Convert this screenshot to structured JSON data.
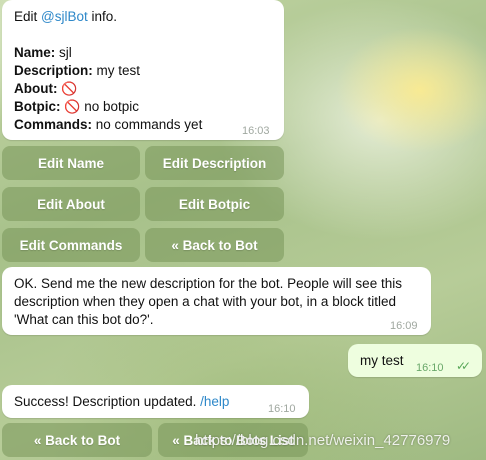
{
  "bot_info": {
    "intro_prefix": "Edit ",
    "bot_handle": "@sjlBot",
    "intro_suffix": " info.",
    "name_label": "Name:",
    "name_value": " sjl",
    "description_label": "Description:",
    "description_value": " my test",
    "about_label": "About:",
    "about_icon": "🚫",
    "botpic_label": "Botpic:",
    "botpic_icon": "🚫",
    "botpic_value": " no botpic",
    "commands_label": "Commands:",
    "commands_value": " no commands yet",
    "time": "16:03"
  },
  "keyboard": {
    "edit_name": "Edit Name",
    "edit_description": "Edit Description",
    "edit_about": "Edit About",
    "edit_botpic": "Edit Botpic",
    "edit_commands": "Edit Commands",
    "back_to_bot": "« Back to Bot"
  },
  "prompt_message": {
    "text": "OK. Send me the new description for the bot. People will see this description when they open a chat with your bot, in a block titled 'What can this bot do?'.",
    "time": "16:09"
  },
  "outgoing_message": {
    "text": "my test",
    "time": "16:10",
    "status": "read-double-check-icon"
  },
  "success_message": {
    "text": "Success! Description updated. ",
    "link": "/help",
    "time": "16:10"
  },
  "bottom_keyboard": {
    "back_to_bot": "« Back to Bot",
    "back_to_bots_list": "« Back to Bots List"
  },
  "watermark": "https://blog.csdn.net/weixin_42776979"
}
